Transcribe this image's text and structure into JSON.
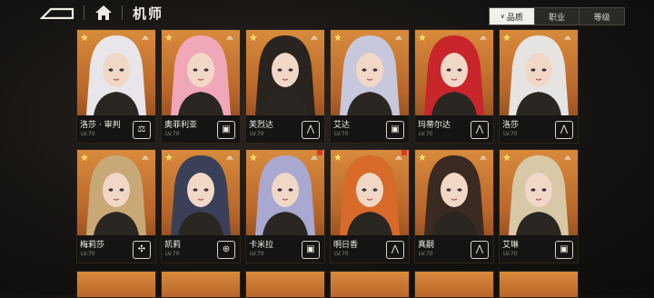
{
  "header": {
    "title": "机师",
    "back_icon": "back-arrow-icon",
    "home_icon": "home-icon"
  },
  "filters": [
    {
      "label": "品质",
      "active": true,
      "indicator": "∨"
    },
    {
      "label": "职业",
      "active": false,
      "indicator": ""
    },
    {
      "label": "等级",
      "active": false,
      "indicator": ""
    }
  ],
  "colors": {
    "card_bg": "#c9762f",
    "info_bg": "#151412",
    "star": "#f7e06a",
    "flag": "#d83a2a",
    "hair": [
      "#e8e6ea",
      "#f0a7b8",
      "#2a2420",
      "#c8c8dc",
      "#c8262a",
      "#e6e4e2",
      "#c9a878",
      "#3a4058",
      "#a8a8d0",
      "#d86a2a",
      "#3a2a22",
      "#d8c8a8"
    ]
  },
  "pilots": [
    {
      "name": "洛莎 · 审判",
      "level": "LV.70",
      "class_icon": "judge-class-icon",
      "class_glyph": "⚖",
      "new": false
    },
    {
      "name": "奥菲利亚",
      "level": "LV.70",
      "class_icon": "shield-class-icon",
      "class_glyph": "▣",
      "new": false
    },
    {
      "name": "芙烈达",
      "level": "LV.70",
      "class_icon": "blade-class-icon",
      "class_glyph": "⋀",
      "new": false
    },
    {
      "name": "艾达",
      "level": "LV.70",
      "class_icon": "shield-class-icon",
      "class_glyph": "▣",
      "new": false
    },
    {
      "name": "玛蒂尔达",
      "level": "LV.70",
      "class_icon": "blade-class-icon",
      "class_glyph": "⋀",
      "new": false
    },
    {
      "name": "洛莎",
      "level": "LV.70",
      "class_icon": "blade-class-icon",
      "class_glyph": "⋀",
      "new": false
    },
    {
      "name": "梅莉莎",
      "level": "LV.70",
      "class_icon": "support-class-icon",
      "class_glyph": "✣",
      "new": false
    },
    {
      "name": "凯莉",
      "level": "LV.70",
      "class_icon": "target-class-icon",
      "class_glyph": "⊕",
      "new": false
    },
    {
      "name": "卡米拉",
      "level": "LV.70",
      "class_icon": "shield-class-icon",
      "class_glyph": "▣",
      "new": true
    },
    {
      "name": "明日香",
      "level": "LV.70",
      "class_icon": "blade-class-icon",
      "class_glyph": "⋀",
      "new": true
    },
    {
      "name": "真嗣",
      "level": "LV.70",
      "class_icon": "blade-class-icon",
      "class_glyph": "⋀",
      "new": false
    },
    {
      "name": "艾琳",
      "level": "LV.70",
      "class_icon": "shield-class-icon",
      "class_glyph": "▣",
      "new": false
    }
  ]
}
